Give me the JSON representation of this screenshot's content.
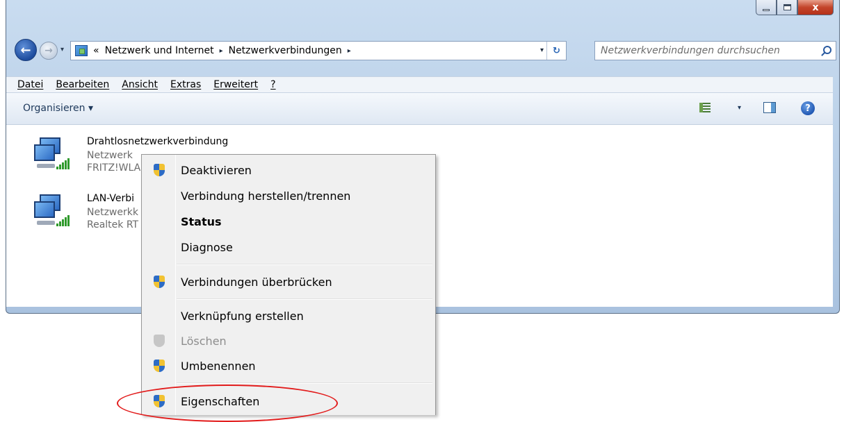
{
  "window": {
    "buttons": {
      "minimize_icon": "minimize-icon",
      "maximize_icon": "maximize-icon",
      "close_glyph": "x"
    }
  },
  "address": {
    "overflow": "«",
    "crumbs": [
      "Netzwerk und Internet",
      "Netzwerkverbindungen"
    ],
    "separator": "▸",
    "dropdown": "▾",
    "refresh": "↻"
  },
  "search": {
    "placeholder": "Netzwerkverbindungen durchsuchen"
  },
  "nav": {
    "back": "←",
    "forward": "→",
    "history": "▾"
  },
  "menubar": [
    "Datei",
    "Bearbeiten",
    "Ansicht",
    "Extras",
    "Erweitert",
    "?"
  ],
  "command_bar": {
    "organize": "Organisieren ▾",
    "views_dropdown": "▾",
    "help": "?"
  },
  "connections": [
    {
      "title": "Drahtlosnetzwerkverbindung",
      "line1": "Netzwerk",
      "line2": "FRITZ!WLA"
    },
    {
      "title": "LAN-Verbi",
      "line1": "Netzwerkk",
      "line2": "Realtek RT"
    }
  ],
  "context_menu": {
    "items": [
      {
        "label": "Deaktivieren",
        "shield": true
      },
      {
        "label": "Verbindung herstellen/trennen",
        "shield": false
      },
      {
        "label": "Status",
        "shield": false,
        "bold": true
      },
      {
        "label": "Diagnose",
        "shield": false
      },
      {
        "label": "Verbindungen überbrücken",
        "shield": true
      },
      {
        "label": "Verknüpfung erstellen",
        "shield": false
      },
      {
        "label": "Löschen",
        "shield": true,
        "disabled": true
      },
      {
        "label": "Umbenennen",
        "shield": true
      },
      {
        "label": "Eigenschaften",
        "shield": true,
        "highlighted": true
      }
    ]
  },
  "colors": {
    "annotation": "#e21b1b",
    "accent": "#2d6cc6"
  }
}
